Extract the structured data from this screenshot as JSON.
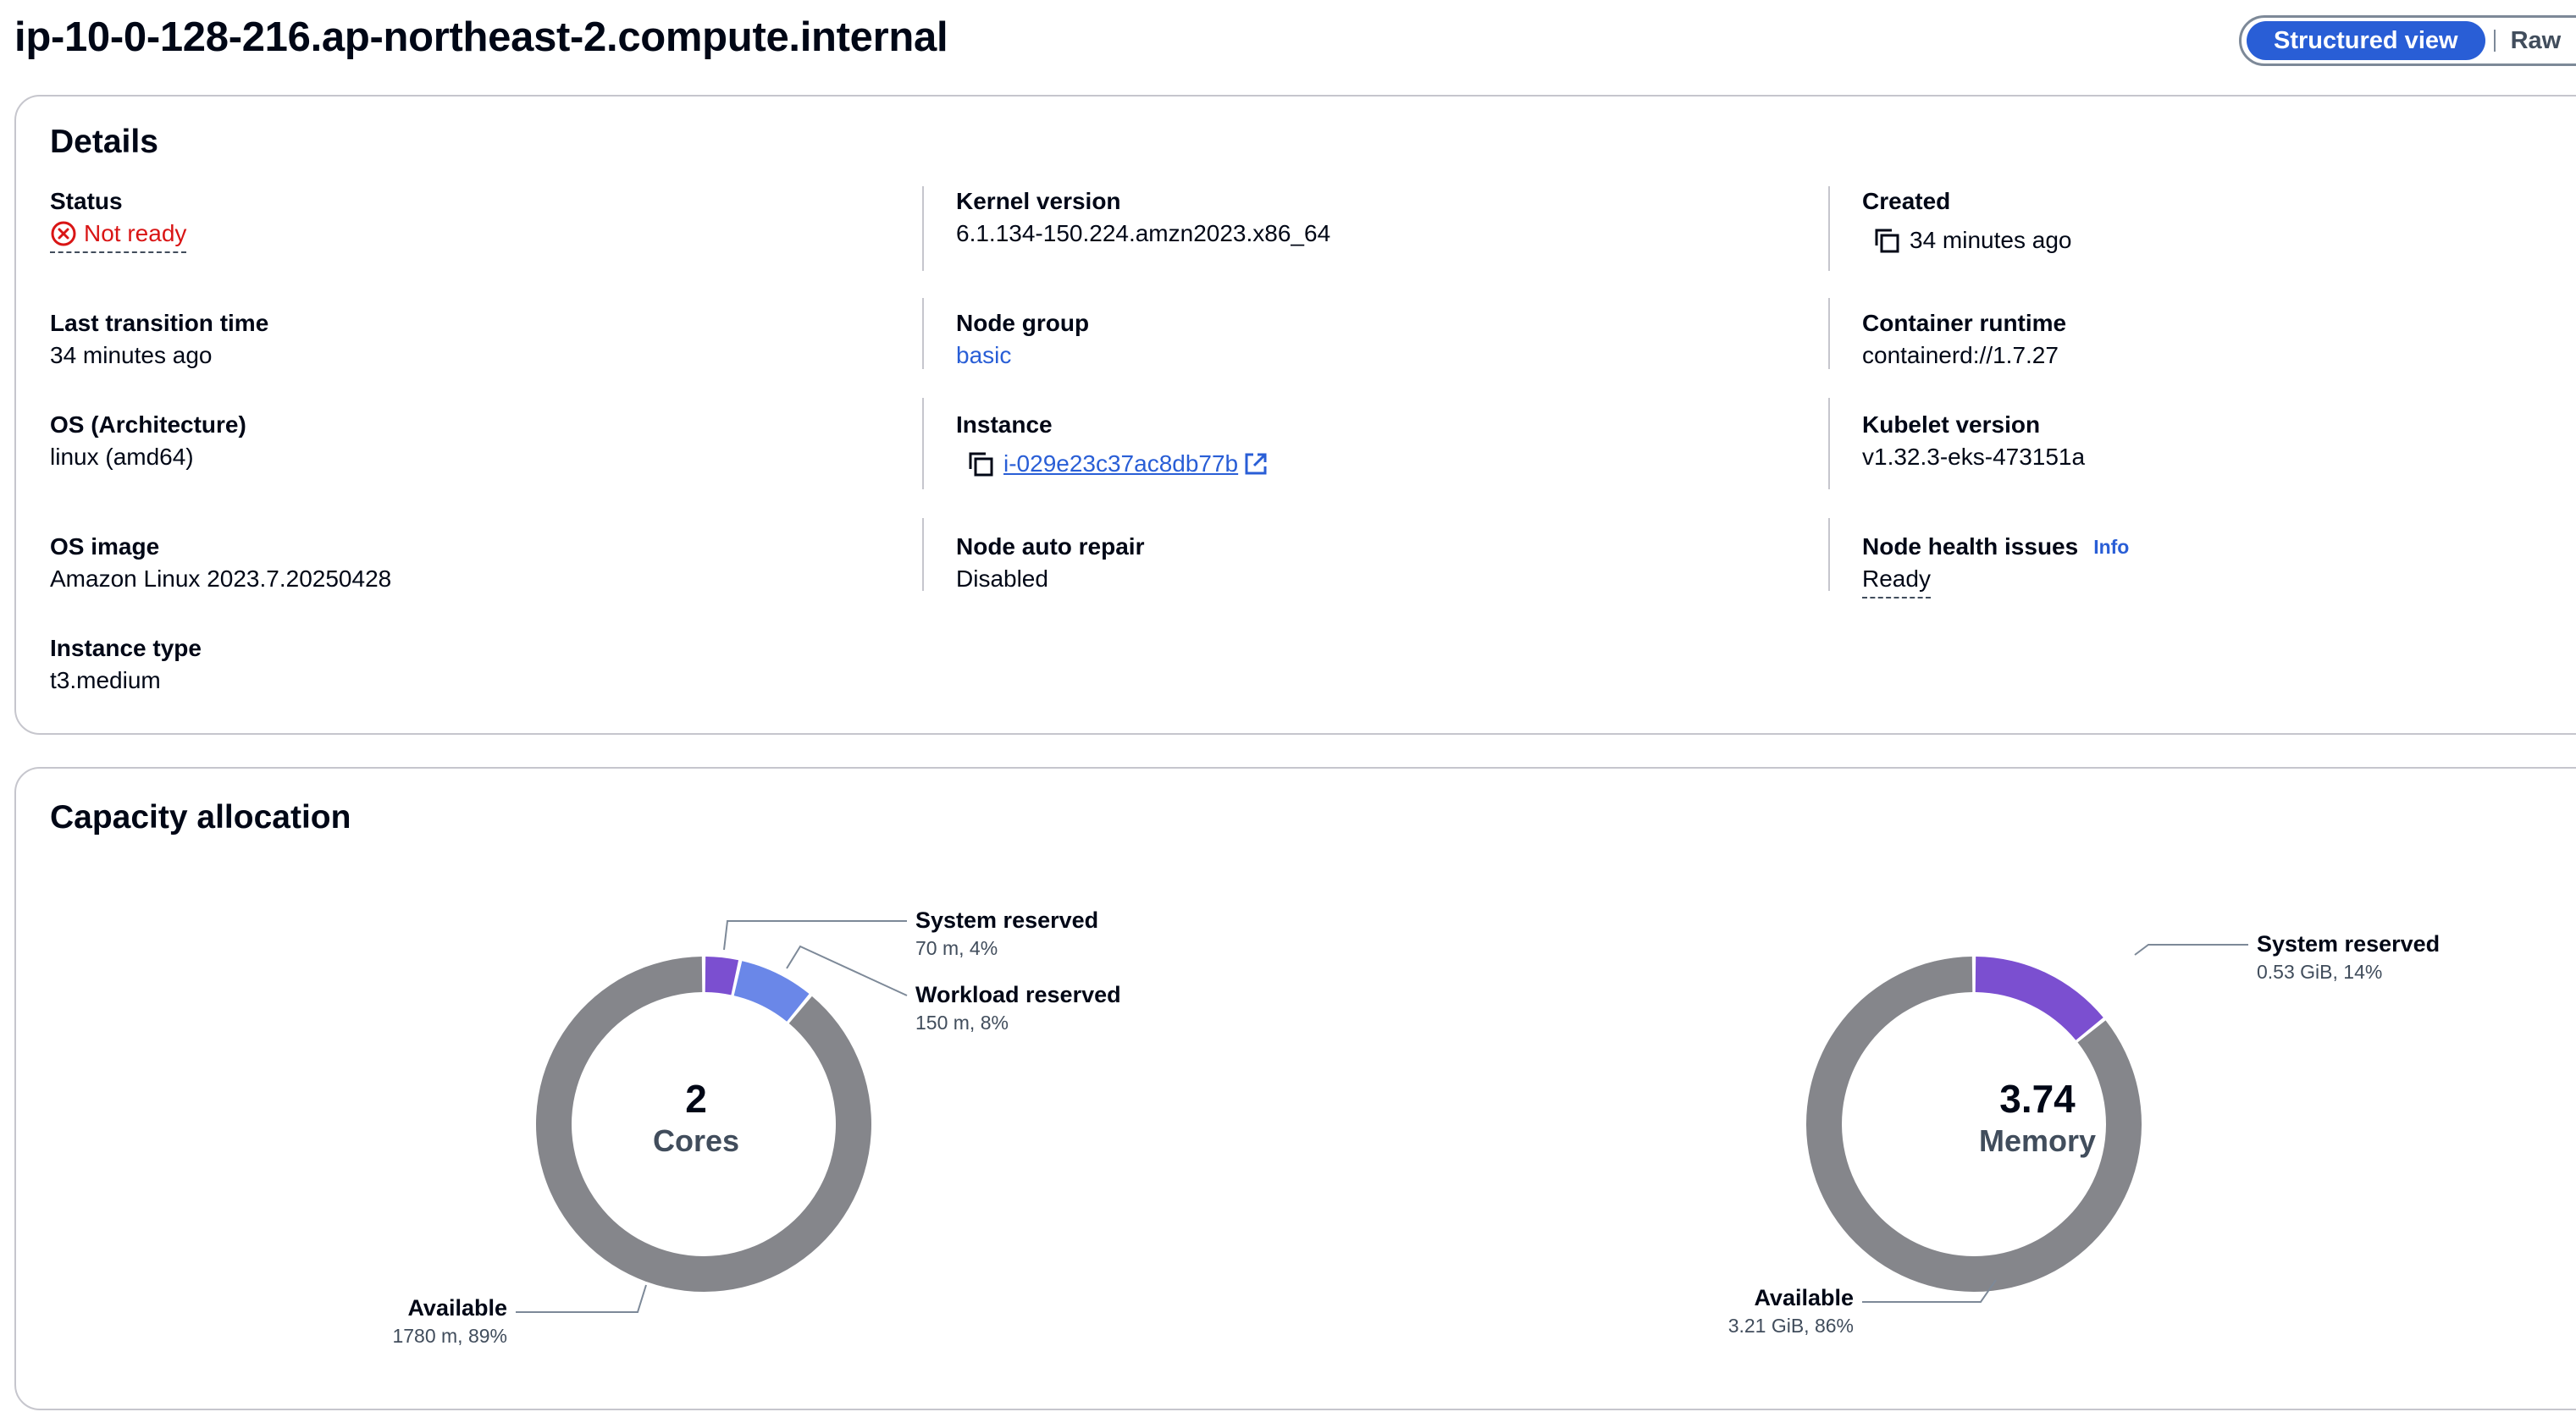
{
  "header": {
    "title": "ip-10-0-128-216.ap-northeast-2.compute.internal",
    "view_structured": "Structured view",
    "view_raw": "Raw"
  },
  "details": {
    "heading": "Details",
    "status_label": "Status",
    "status_value": "Not ready",
    "last_transition_label": "Last transition time",
    "last_transition_value": "34 minutes ago",
    "os_arch_label": "OS (Architecture)",
    "os_arch_value": "linux (amd64)",
    "os_image_label": "OS image",
    "os_image_value": "Amazon Linux 2023.7.20250428",
    "instance_type_label": "Instance type",
    "instance_type_value": "t3.medium",
    "kernel_label": "Kernel version",
    "kernel_value": "6.1.134-150.224.amzn2023.x86_64",
    "node_group_label": "Node group",
    "node_group_value": "basic",
    "instance_label": "Instance",
    "instance_value": "i-029e23c37ac8db77b",
    "auto_repair_label": "Node auto repair",
    "auto_repair_value": "Disabled",
    "created_label": "Created",
    "created_value": "34 minutes ago",
    "runtime_label": "Container runtime",
    "runtime_value": "containerd://1.7.27",
    "kubelet_label": "Kubelet version",
    "kubelet_value": "v1.32.3-eks-473151a",
    "health_label": "Node health issues",
    "health_info": "Info",
    "health_value": "Ready"
  },
  "capacity": {
    "heading": "Capacity allocation",
    "colors": {
      "system": "#7b4fd0",
      "workload": "#6a87e8",
      "available": "#85868b"
    },
    "cpu": {
      "value": "2",
      "unit": "Cores",
      "segments": [
        {
          "label": "System reserved",
          "detail": "70 m, 4%",
          "fraction": 0.035
        },
        {
          "label": "Workload reserved",
          "detail": "150 m, 8%",
          "fraction": 0.075
        },
        {
          "label": "Available",
          "detail": "1780 m, 89%",
          "fraction": 0.89
        }
      ]
    },
    "memory": {
      "value": "3.74",
      "unit": "Memory",
      "segments": [
        {
          "label": "System reserved",
          "detail": "0.53 GiB, 14%",
          "fraction": 0.142
        },
        {
          "label": "Available",
          "detail": "3.21 GiB, 86%",
          "fraction": 0.858
        }
      ]
    }
  }
}
